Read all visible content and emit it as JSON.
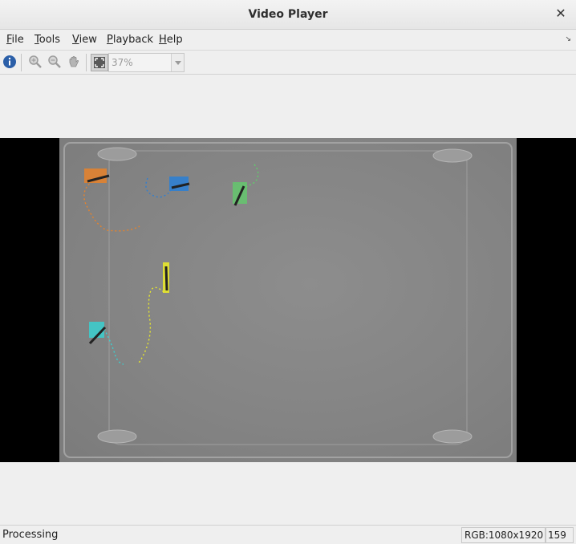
{
  "window": {
    "title": "Video Player",
    "close_glyph": "✕"
  },
  "menu": {
    "items": [
      {
        "mnemonic": "F",
        "rest": "ile"
      },
      {
        "mnemonic": "T",
        "rest": "ools"
      },
      {
        "mnemonic": "V",
        "rest": "iew"
      },
      {
        "mnemonic": "P",
        "rest": "layback"
      },
      {
        "mnemonic": "H",
        "rest": "elp"
      }
    ],
    "undock_glyph": "↘"
  },
  "toolbar": {
    "icons": [
      "info-icon",
      "zoom-in-icon",
      "zoom-out-icon",
      "pan-hand-icon",
      "fit-to-window-icon"
    ],
    "zoom_value": "37%"
  },
  "tracks": [
    {
      "color": "#e8832a",
      "label": "orange"
    },
    {
      "color": "#2f7fd1",
      "label": "blue"
    },
    {
      "color": "#5fcf6a",
      "label": "green"
    },
    {
      "color": "#e8e82c",
      "label": "yellow"
    },
    {
      "color": "#3ad0d0",
      "label": "cyan"
    }
  ],
  "status": {
    "text": "Processing",
    "format": "RGB:1080x1920",
    "frame": "159"
  }
}
